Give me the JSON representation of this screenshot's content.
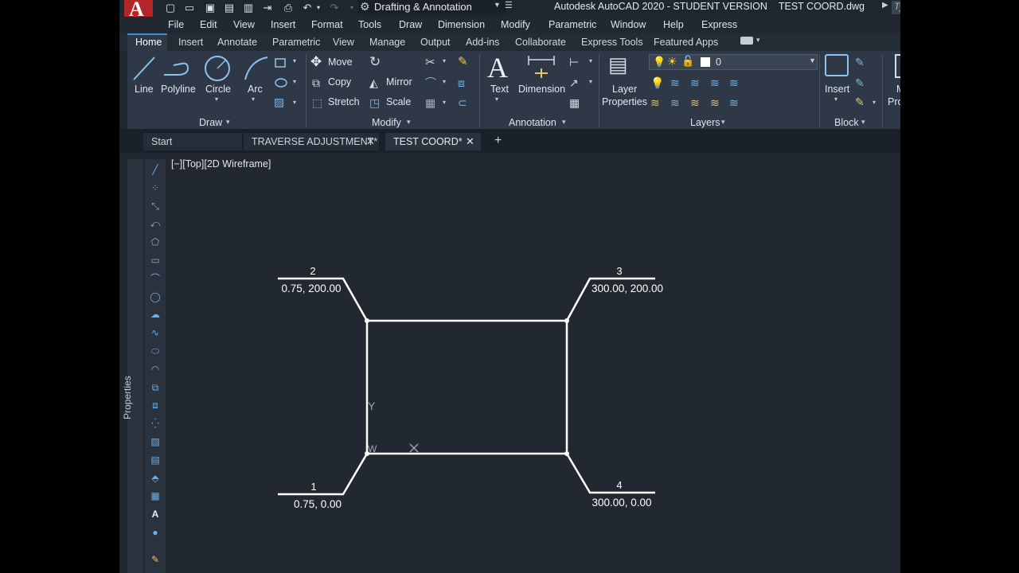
{
  "titlebar": {
    "logo_letter": "A",
    "workspace": "Drafting & Annotation",
    "app_title": "Autodesk AutoCAD 2020 - STUDENT VERSION",
    "file_name": "TEST COORD.dwg",
    "partial_right": "Ty"
  },
  "menus": [
    "File",
    "Edit",
    "View",
    "Insert",
    "Format",
    "Tools",
    "Draw",
    "Dimension",
    "Modify",
    "Parametric",
    "Window",
    "Help",
    "Express"
  ],
  "ribbon_tabs": [
    "Home",
    "Insert",
    "Annotate",
    "Parametric",
    "View",
    "Manage",
    "Output",
    "Add-ins",
    "Collaborate",
    "Express Tools",
    "Featured Apps"
  ],
  "ribbon": {
    "draw": {
      "line": "Line",
      "polyline": "Polyline",
      "circle": "Circle",
      "arc": "Arc",
      "label": "Draw"
    },
    "modify": {
      "move": "Move",
      "copy": "Copy",
      "stretch": "Stretch",
      "mirror": "Mirror",
      "scale": "Scale",
      "label": "Modify"
    },
    "annotation": {
      "text": "Text",
      "dimension": "Dimension",
      "label": "Annotation"
    },
    "layers": {
      "layer_properties_1": "Layer",
      "layer_properties_2": "Properties",
      "current_layer": "0",
      "label": "Layers"
    },
    "block": {
      "insert": "Insert",
      "label": "Block",
      "partial_1": "M",
      "partial_2": "Pro"
    }
  },
  "doc_tabs": [
    "Start",
    "TRAVERSE ADJUSTMENT*",
    "TEST COORD*"
  ],
  "properties_label": "Properties",
  "viewport_controls": "[−][Top][2D Wireframe]",
  "points": [
    {
      "id": "1",
      "coords": "0.75, 0.00"
    },
    {
      "id": "2",
      "coords": "0.75, 200.00"
    },
    {
      "id": "3",
      "coords": "300.00, 200.00"
    },
    {
      "id": "4",
      "coords": "300.00, 0.00"
    }
  ],
  "ucs": {
    "y": "Y",
    "w": "W"
  },
  "colors": {
    "canvas": "#212830",
    "ribbon": "#2e3846",
    "accent": "#3b8be0",
    "logo": "#b4252a"
  }
}
